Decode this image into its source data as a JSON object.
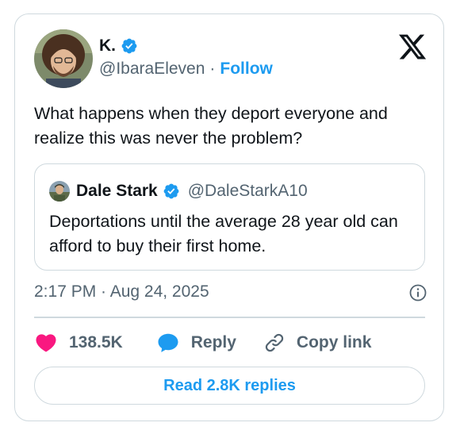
{
  "author": {
    "display_name": "K.",
    "handle": "@IbaraEleven",
    "separator": "·",
    "follow_label": "Follow"
  },
  "tweet": {
    "text": "What happens when they deport everyone and realize this was never the problem?",
    "timestamp": "2:17 PM · Aug 24, 2025"
  },
  "quoted_tweet": {
    "display_name": "Dale Stark",
    "handle": "@DaleStarkA10",
    "text": "Deportations until the average 28 year old can afford to buy their first home."
  },
  "actions": {
    "like_count": "138.5K",
    "reply_label": "Reply",
    "copy_link_label": "Copy link"
  },
  "read_replies_label": "Read 2.8K replies",
  "icons": {
    "logo": "x-logo-icon",
    "verified": "verified-badge-icon",
    "info": "info-icon",
    "like": "heart-icon",
    "reply": "speech-bubble-icon",
    "copy": "link-icon"
  },
  "colors": {
    "accent": "#1d9bf0",
    "like": "#f91880",
    "text": "#0f1419",
    "secondary_text": "#536471",
    "border": "#cfd9de"
  }
}
